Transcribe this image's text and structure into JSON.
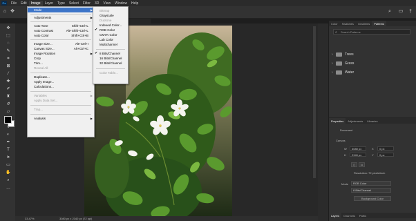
{
  "app": {
    "logo": "Ps",
    "menus": [
      "File",
      "Edit",
      "Image",
      "Layer",
      "Type",
      "Select",
      "Filter",
      "3D",
      "View",
      "Window",
      "Help"
    ],
    "active_menu": "Image"
  },
  "document": {
    "tab_title": "@ 33.3% (RGB/8*)",
    "zoom": "33.47%",
    "size_info": "3080 px x 2340 px (72 ppi)"
  },
  "image_menu": {
    "mode": "Mode",
    "adjustments": "Adjustments",
    "auto_tone": "Auto Tone",
    "auto_tone_sc": "Shift+Ctrl+L",
    "auto_contrast": "Auto Contrast",
    "auto_contrast_sc": "Alt+Shift+Ctrl+L",
    "auto_color": "Auto Color",
    "auto_color_sc": "Shift+Ctrl+B",
    "image_size": "Image Size...",
    "image_size_sc": "Alt+Ctrl+I",
    "canvas_size": "Canvas Size...",
    "canvas_size_sc": "Alt+Ctrl+C",
    "image_rotation": "Image Rotation",
    "crop": "Crop",
    "trim": "Trim...",
    "reveal_all": "Reveal All",
    "duplicate": "Duplicate...",
    "apply_image": "Apply Image...",
    "calculations": "Calculations...",
    "variables": "Variables",
    "apply_data_set": "Apply Data Set...",
    "trap": "Trap...",
    "analysis": "Analysis"
  },
  "mode_menu": {
    "bitmap": "Bitmap",
    "grayscale": "Grayscale",
    "duotone": "Duotone",
    "indexed": "Indexed Color...",
    "rgb": "RGB Color",
    "cmyk": "CMYK Color",
    "lab": "Lab Color",
    "multichannel": "Multichannel",
    "bits8": "8 Bits/Channel",
    "bits16": "16 Bits/Channel",
    "bits32": "32 Bits/Channel",
    "color_table": "Color Table..."
  },
  "right_panel": {
    "tabs": [
      "Color",
      "Swatches",
      "Gradients",
      "Patterns"
    ],
    "search_placeholder": "Search Patterns",
    "folders": [
      "Trees",
      "Grass",
      "Water"
    ]
  },
  "properties": {
    "tabs": [
      "Properties",
      "Adjustments",
      "Libraries"
    ],
    "doc_label": "Document",
    "canvas_label": "Canvas",
    "w_label": "W",
    "w_value": "3080 px",
    "h_label": "H",
    "h_value": "2340 px",
    "x_label": "X",
    "x_value": "0 px",
    "y_label": "Y",
    "y_value": "0 px",
    "resolution": "Resolution: 72 pixels/inch",
    "mode_label": "Mode",
    "mode_value": "RGB Color",
    "bits_value": "8 Bits/Channel",
    "fill_button": "Background Color",
    "bottom_tabs": [
      "Layers",
      "Channels",
      "Paths"
    ]
  },
  "colors": {
    "highlight": "#3c74c8",
    "foreground": "#000000",
    "background": "#ffffff"
  }
}
